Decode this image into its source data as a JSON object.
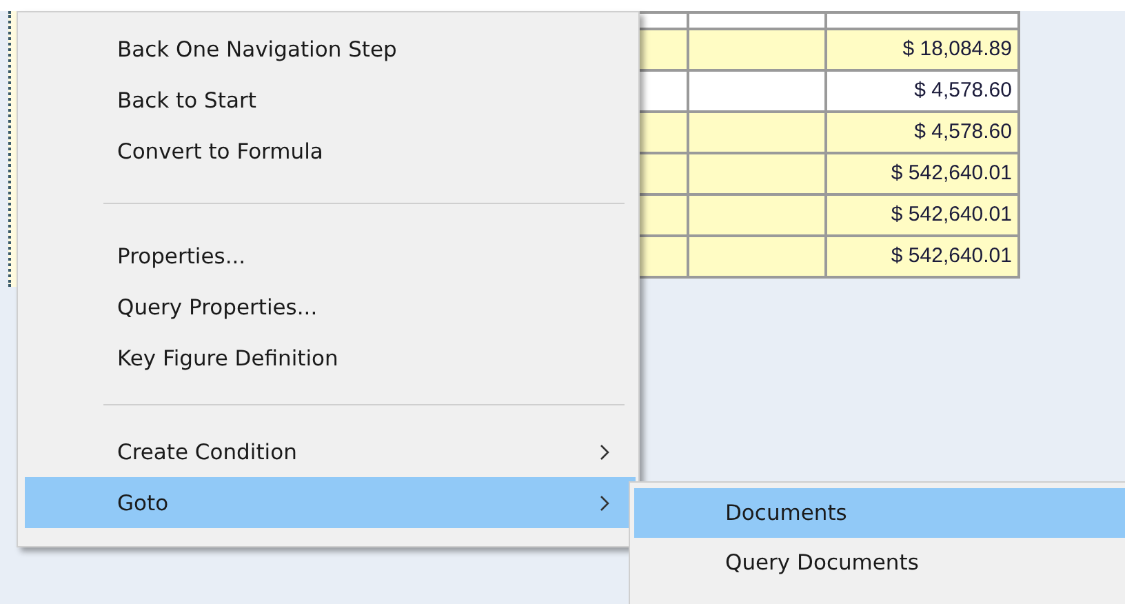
{
  "table": {
    "rows": [
      {
        "cells": [
          "",
          "",
          "$ 18,084.89"
        ],
        "highlighted": true
      },
      {
        "cells": [
          "",
          "",
          "$ 4,578.60"
        ],
        "highlighted": false
      },
      {
        "cells": [
          "",
          "",
          "$ 4,578.60"
        ],
        "highlighted": true
      },
      {
        "cells": [
          "",
          "",
          "$ 542,640.01"
        ],
        "highlighted": true
      },
      {
        "cells": [
          "",
          "",
          "$ 542,640.01"
        ],
        "highlighted": true
      },
      {
        "cells": [
          "",
          "",
          "$ 542,640.01"
        ],
        "highlighted": true
      }
    ]
  },
  "context_menu": {
    "items": [
      {
        "kind": "item",
        "label": "Back One Navigation Step",
        "has_submenu": false,
        "selected": false
      },
      {
        "kind": "item",
        "label": "Back to Start",
        "has_submenu": false,
        "selected": false
      },
      {
        "kind": "item",
        "label": "Convert to Formula",
        "has_submenu": false,
        "selected": false
      },
      {
        "kind": "separator"
      },
      {
        "kind": "item",
        "label": "Properties...",
        "has_submenu": false,
        "selected": false
      },
      {
        "kind": "item",
        "label": "Query Properties...",
        "has_submenu": false,
        "selected": false
      },
      {
        "kind": "item",
        "label": "Key Figure Definition",
        "has_submenu": false,
        "selected": false
      },
      {
        "kind": "separator"
      },
      {
        "kind": "item",
        "label": "Create Condition",
        "has_submenu": true,
        "selected": false
      },
      {
        "kind": "item",
        "label": "Goto",
        "has_submenu": true,
        "selected": true
      }
    ]
  },
  "submenu": {
    "items": [
      {
        "label": "Documents",
        "selected": true
      },
      {
        "label": "Query Documents",
        "selected": false
      }
    ]
  }
}
